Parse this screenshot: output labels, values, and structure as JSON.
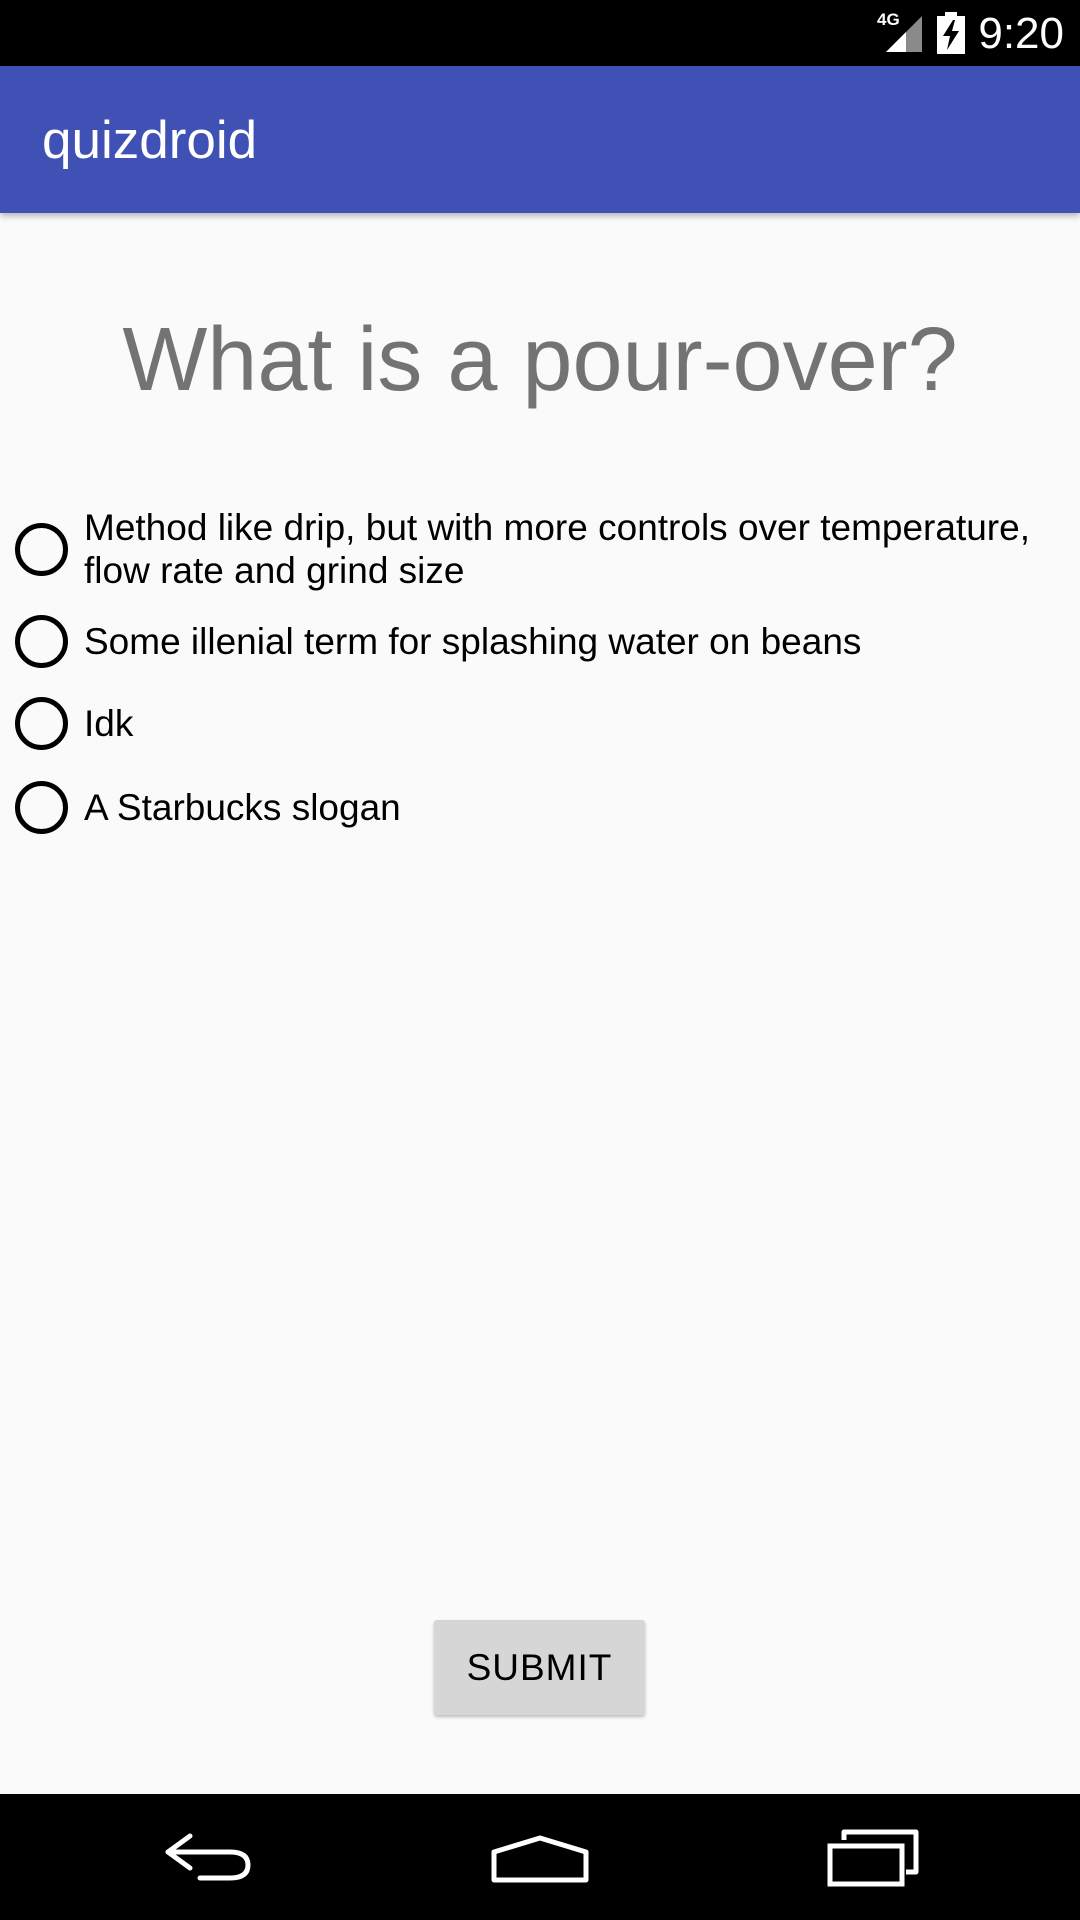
{
  "status_bar": {
    "network": "4G",
    "time": "9:20",
    "icons": [
      "signal-icon",
      "battery-charging-icon"
    ]
  },
  "app_bar": {
    "title": "quizdroid",
    "color": "#3f51b5"
  },
  "question": {
    "text": "What is a pour-over?"
  },
  "options": [
    {
      "label": "Method like drip, but with more controls over temperature, flow rate and grind size"
    },
    {
      "label": "Some illenial term for splashing water on beans"
    },
    {
      "label": "Idk"
    },
    {
      "label": "A Starbucks slogan"
    }
  ],
  "submit": {
    "label": "SUBMIT"
  },
  "nav_bar": {
    "icons": [
      "back-icon",
      "home-icon",
      "recents-icon"
    ]
  }
}
